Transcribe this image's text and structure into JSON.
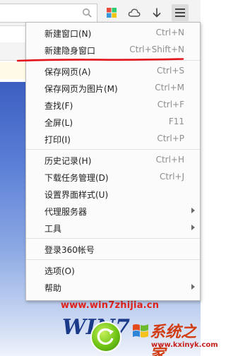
{
  "menu": {
    "groups": [
      [
        {
          "label": "新建窗口(N)",
          "shortcut": "Ctrl+N"
        },
        {
          "label": "新建隐身窗口",
          "shortcut": "Ctrl+Shift+N"
        }
      ],
      [
        {
          "label": "保存网页(A)",
          "shortcut": "Ctrl+S"
        },
        {
          "label": "保存网页为图片(M)",
          "shortcut": "Ctrl+M"
        },
        {
          "label": "查找(F)",
          "shortcut": "Ctrl+F"
        },
        {
          "label": "全屏(L)",
          "shortcut": "F11"
        },
        {
          "label": "打印(I)",
          "shortcut": "Ctrl+P"
        }
      ],
      [
        {
          "label": "历史记录(H)",
          "shortcut": "Ctrl+H"
        },
        {
          "label": "下载任务管理(D)",
          "shortcut": "Ctrl+J"
        },
        {
          "label": "设置界面样式(U)",
          "shortcut": ""
        },
        {
          "label": "代理服务器",
          "shortcut": "",
          "submenu": true
        },
        {
          "label": "工具",
          "shortcut": "",
          "submenu": true
        }
      ],
      [
        {
          "label": "登录360帐号",
          "shortcut": ""
        }
      ],
      [
        {
          "label": "选项(O)",
          "shortcut": ""
        },
        {
          "label": "帮助",
          "shortcut": "",
          "submenu": true
        }
      ]
    ]
  },
  "toolbar": {
    "icons": [
      "search-icon",
      "apps-icon",
      "cloud-icon",
      "download-icon",
      "menu-icon"
    ]
  },
  "watermark": {
    "url": "www.win7zhijia.cn",
    "win_text": "WIN7",
    "cn_text": "系统之家",
    "site": "www.kxinyk.com"
  },
  "colors": {
    "annotation_red": "#e3141b",
    "watermark_red": "#e2231a",
    "page_blue": "#3c5fc2"
  }
}
